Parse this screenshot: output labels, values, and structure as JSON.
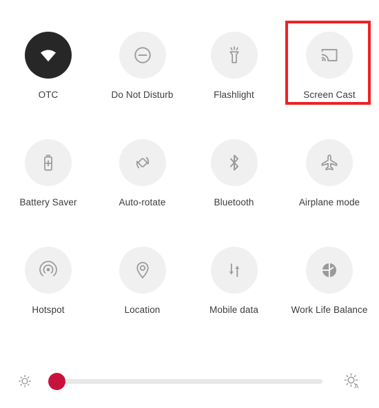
{
  "panel": {
    "name": "quick-settings-panel",
    "background_color": "#ffffff"
  },
  "highlight": {
    "target": "Screen Cast",
    "color": "#ee2222",
    "border_width_px": 4
  },
  "tiles": [
    {
      "id": "otc",
      "label": "OTC",
      "icon": "wifi-icon",
      "state": "on",
      "bubble_color": "#272727",
      "icon_color": "#ffffff"
    },
    {
      "id": "do-not-disturb",
      "label": "Do Not Disturb",
      "icon": "minus-circle-icon",
      "state": "off",
      "bubble_color": "#f0f0f0",
      "icon_color": "#9a9a9a"
    },
    {
      "id": "flashlight",
      "label": "Flashlight",
      "icon": "flashlight-icon",
      "state": "off",
      "bubble_color": "#f0f0f0",
      "icon_color": "#9a9a9a"
    },
    {
      "id": "screen-cast",
      "label": "Screen Cast",
      "icon": "screen-cast-icon",
      "state": "off",
      "bubble_color": "#f0f0f0",
      "icon_color": "#9a9a9a"
    },
    {
      "id": "battery-saver",
      "label": "Battery Saver",
      "icon": "battery-plus-icon",
      "state": "off",
      "bubble_color": "#f0f0f0",
      "icon_color": "#9a9a9a"
    },
    {
      "id": "auto-rotate",
      "label": "Auto-rotate",
      "icon": "auto-rotate-icon",
      "state": "off",
      "bubble_color": "#f0f0f0",
      "icon_color": "#9a9a9a"
    },
    {
      "id": "bluetooth",
      "label": "Bluetooth",
      "icon": "bluetooth-icon",
      "state": "off",
      "bubble_color": "#f0f0f0",
      "icon_color": "#9a9a9a"
    },
    {
      "id": "airplane-mode",
      "label": "Airplane mode",
      "icon": "airplane-icon",
      "state": "off",
      "bubble_color": "#f0f0f0",
      "icon_color": "#9a9a9a"
    },
    {
      "id": "hotspot",
      "label": "Hotspot",
      "icon": "hotspot-icon",
      "state": "off",
      "bubble_color": "#f0f0f0",
      "icon_color": "#9a9a9a"
    },
    {
      "id": "location",
      "label": "Location",
      "icon": "location-pin-icon",
      "state": "off",
      "bubble_color": "#f0f0f0",
      "icon_color": "#9a9a9a"
    },
    {
      "id": "mobile-data",
      "label": "Mobile data",
      "icon": "mobile-data-arrows-icon",
      "state": "off",
      "bubble_color": "#f0f0f0",
      "icon_color": "#9a9a9a"
    },
    {
      "id": "work-life-balance",
      "label": "Work Life Balance",
      "icon": "work-life-balance-icon",
      "state": "off",
      "bubble_color": "#f0f0f0",
      "icon_color": "#9a9a9a"
    }
  ],
  "brightness": {
    "low_icon": "brightness-low-icon",
    "auto_icon": "brightness-auto-icon",
    "auto_letter": "A",
    "value_percent": 0,
    "thumb_color": "#c8123c",
    "track_color": "#e8e8e8"
  }
}
